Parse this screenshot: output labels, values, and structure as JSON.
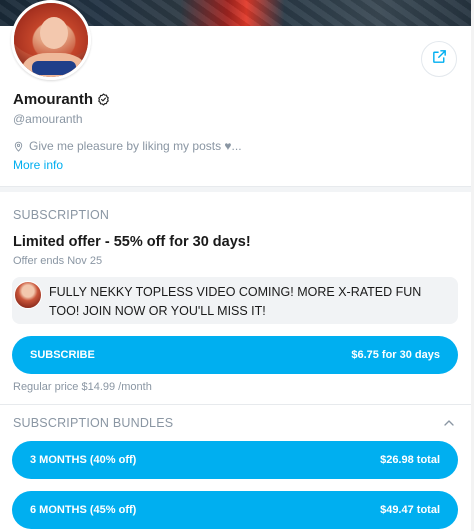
{
  "profile": {
    "name": "Amouranth",
    "username": "@amouranth",
    "bio": "Give me pleasure by liking my posts ♥...",
    "more_info": "More info"
  },
  "subscription": {
    "section_title": "SUBSCRIPTION",
    "offer_title": "Limited offer - 55% off for 30 days!",
    "offer_ends": "Offer ends Nov 25",
    "message": "FULLY NEKKY TOPLESS VIDEO COMING! MORE X-RATED FUN TOO! JOIN NOW OR YOU'LL MISS IT!",
    "subscribe_label": "SUBSCRIBE",
    "subscribe_price": "$6.75 for 30 days",
    "regular_price": "Regular price $14.99 /month"
  },
  "bundles": {
    "section_title": "SUBSCRIPTION BUNDLES",
    "items": [
      {
        "label": "3 MONTHS (40% off)",
        "price": "$26.98 total"
      },
      {
        "label": "6 MONTHS (45% off)",
        "price": "$49.47 total"
      }
    ]
  },
  "colors": {
    "accent": "#00aff0",
    "muted": "#8a96a3"
  },
  "icons": {
    "share": "share-icon",
    "verified": "verified-icon",
    "location": "location-pin-icon",
    "collapse": "chevron-up-icon"
  }
}
